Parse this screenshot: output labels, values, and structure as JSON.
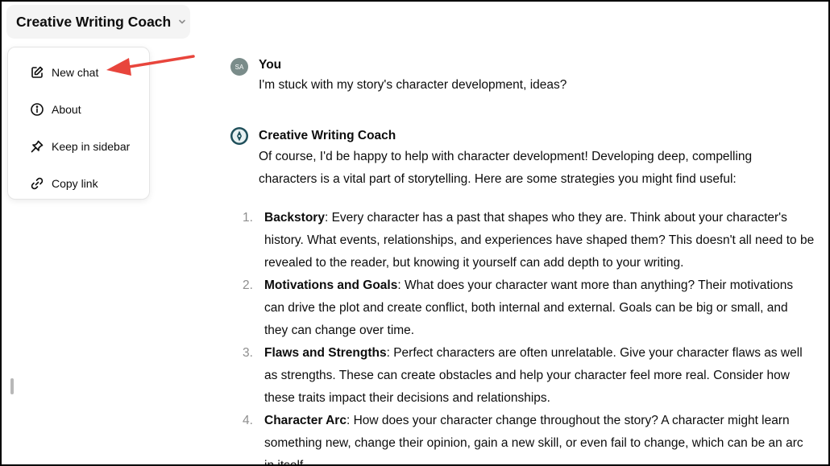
{
  "header": {
    "gpt_name": "Creative Writing Coach"
  },
  "menu": {
    "items": [
      {
        "label": "New chat",
        "icon": "edit-icon"
      },
      {
        "label": "About",
        "icon": "info-icon"
      },
      {
        "label": "Keep in sidebar",
        "icon": "pin-icon"
      },
      {
        "label": "Copy link",
        "icon": "link-icon"
      }
    ]
  },
  "conversation": {
    "user": {
      "initials": "SA",
      "name": "You",
      "message": "I'm stuck with my story's character development, ideas?"
    },
    "assistant": {
      "name": "Creative Writing Coach",
      "intro": "Of course, I'd be happy to help with character development! Developing deep, compelling characters is a vital part of storytelling. Here are some strategies you might find useful:",
      "points": [
        {
          "num": "1.",
          "term": "Backstory",
          "text": ": Every character has a past that shapes who they are. Think about your character's history. What events, relationships, and experiences have shaped them? This doesn't all need to be revealed to the reader, but knowing it yourself can add depth to your writing."
        },
        {
          "num": "2.",
          "term": "Motivations and Goals",
          "text": ": What does your character want more than anything? Their motivations can drive the plot and create conflict, both internal and external. Goals can be big or small, and they can change over time."
        },
        {
          "num": "3.",
          "term": "Flaws and Strengths",
          "text": ": Perfect characters are often unrelatable. Give your character flaws as well as strengths. These can create obstacles and help your character feel more real. Consider how these traits impact their decisions and relationships."
        },
        {
          "num": "4.",
          "term": "Character Arc",
          "text": ": How does your character change throughout the story? A character might learn something new, change their opinion, gain a new skill, or even fail to change, which can be an arc in itself."
        }
      ]
    }
  },
  "colors": {
    "arrow": "#e8453c",
    "selector_bg": "#f4f4f4",
    "list_number": "#8e8e8e"
  }
}
